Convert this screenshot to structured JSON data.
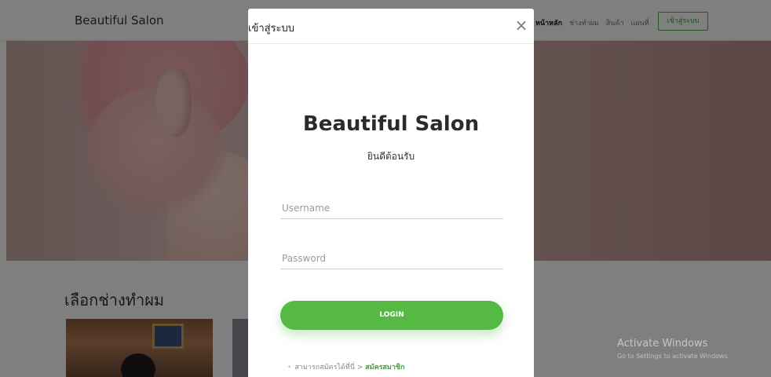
{
  "background": {
    "brand": "Beautiful Salon",
    "nav": {
      "items": [
        "หน้าหลัก",
        "ช่างทำผม",
        "สินค้า",
        "แผนที่"
      ],
      "login_button": "เข้าสู่ระบบ"
    },
    "section_title": "เลือกช่างทำผม"
  },
  "modal": {
    "title": "เข้าสู่ระบบ",
    "close": "×",
    "brand_title": "Beautiful Salon",
    "welcome": "ยินดีต้อนรับ",
    "username_placeholder": "Username",
    "password_placeholder": "Password",
    "login_label": "LOGIN",
    "register_text": "สามารถสมัครได้ที่นี่ >",
    "register_link": "สมัครสมาชิก"
  },
  "watermark": {
    "title": "Activate Windows",
    "subtitle": "Go to Settings to activate Windows."
  },
  "colors": {
    "accent": "#55b944",
    "overlay": "rgba(0,0,0,0.5)"
  }
}
